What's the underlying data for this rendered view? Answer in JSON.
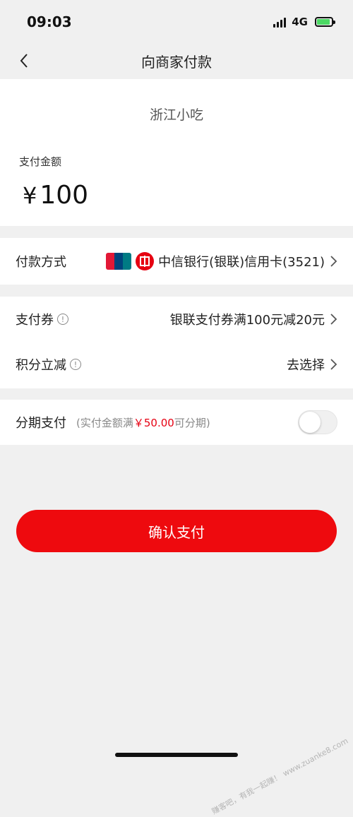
{
  "status": {
    "time": "09:03",
    "network": "4G"
  },
  "nav": {
    "title": "向商家付款",
    "back_icon": "chevron-left-icon"
  },
  "merchant": {
    "name": "浙江小吃",
    "amount_label": "支付金额",
    "currency": "¥",
    "amount": "100"
  },
  "payment_method": {
    "label": "付款方式",
    "card": "中信银行(银联)信用卡(3521)",
    "unionpay_text": "UnionPay 银联",
    "unionpay_colors": [
      "#e21836",
      "#00447c",
      "#007b84"
    ],
    "bank_color": "#e60012"
  },
  "coupon": {
    "label": "支付券",
    "value": "银联支付券满100元减20元"
  },
  "points": {
    "label": "积分立减",
    "value": "去选择"
  },
  "installment": {
    "label": "分期支付",
    "hint_prefix": "(实付金额满",
    "hint_amount": "￥50.00",
    "hint_suffix": "可分期)",
    "enabled": false
  },
  "confirm": {
    "label": "确认支付"
  },
  "watermark": {
    "text": "赚客吧，有我一起赚！",
    "url": "www.zuanke8.com"
  },
  "colors": {
    "accent": "#ee0a0e",
    "background": "#f0f0f0"
  }
}
